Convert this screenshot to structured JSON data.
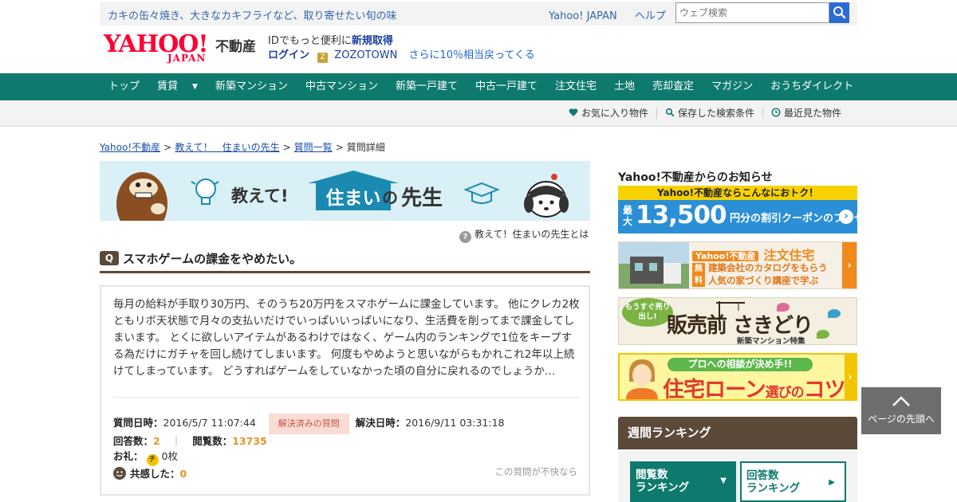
{
  "topbar": {
    "promo": "カキの缶々焼き、大きなカキフライなど、取り寄せたい旬の味",
    "yahoo_japan": "Yahoo! JAPAN",
    "help": "ヘルプ",
    "search_placeholder": "ウェブ検索"
  },
  "header": {
    "logo_text": "YAHOO!",
    "logo_japan": "JAPAN",
    "logo_sub": "不動産",
    "id_prefix": "IDでもっと便利に",
    "new_signup": "新規取得",
    "login": "ログイン",
    "zozo_icon": "Z",
    "zozotown": "ZOZOTOWN",
    "zozo_msg": "さらに10％相当戻ってくる"
  },
  "nav": [
    "トップ",
    "賃貸",
    "新築マンション",
    "中古マンション",
    "新築一戸建て",
    "中古一戸建て",
    "注文住宅",
    "土地",
    "売却査定",
    "マガジン",
    "おうちダイレクト"
  ],
  "nav_caret": "▼",
  "subnav": {
    "favorites": "お気に入り物件",
    "saved_search": "保存した検索条件",
    "recent": "最近見た物件"
  },
  "breadcrumb": {
    "home": "Yahoo!不動産",
    "section": "教えて！　住まいの先生",
    "list": "質問一覧",
    "current": "質問詳細",
    "sep": ">"
  },
  "banner": {
    "teach": "教えて!",
    "sumai": "住まい",
    "no": "の",
    "sensei": "先生"
  },
  "about": {
    "icon": "?",
    "text": "教えて！住まいの先生とは"
  },
  "question": {
    "badge": "Q",
    "title": "スマホゲームの課金をやめたい。",
    "body": "毎月の給料が手取り30万円、そのうち20万円をスマホゲームに課金しています。 他にクレカ2枚ともリボ天状態で月々の支払いだけでいっぱいいっぱいになり、生活費を削ってまで課金してしまいます。 とくに欲しいアイテムがあるわけではなく、ゲーム内のランキングで1位をキープする為だけにガチャを回し続けてしまいます。 何度もやめようと思いながらもかれこれ2年以上続けてしまっています。 どうすればゲームをしていなかった頃の自分に戻れるのでしょうか…",
    "asked_label": "質問日時：",
    "asked_at": "2016/5/7 11:07:44",
    "status": "解決済みの質問",
    "resolved_label": "解決日時：",
    "resolved_at": "2016/9/11 03:31:18",
    "answers_label": "回答数：",
    "answers": "2",
    "pipe": "｜",
    "views_label": "閲覧数：",
    "views": "13735",
    "reward_label": "お礼：",
    "coin": "チ",
    "reward": "0枚",
    "empathy_label": "共感した：",
    "empathy": "0",
    "report": "この質問が不快なら"
  },
  "sidebar": {
    "notice_title": "Yahoo!不動産からのお知らせ",
    "ad1": {
      "top": "Yahoo!不動産ならこんなにおトク！",
      "small": "最大",
      "big": "13,500",
      "mid": "円分の割引クーポンのプレゼント",
      "arrow": "›"
    },
    "ad2": {
      "logo": "Yahoo!不動産",
      "kind": "注文住宅",
      "free": "無料",
      "line1": "建築会社のカタログをもらう",
      "line2": "人気の家づくり講座で学ぶ",
      "arrow": "›"
    },
    "ad3": {
      "badge": "もうすぐ売り出し!",
      "main": "販売前 さきどり",
      "sub": "新築マンション特集"
    },
    "ad4": {
      "pill": "プロへの相談が決め手!!",
      "main_a": "住宅ローン",
      "main_b": "選び",
      "main_c": "の",
      "main_d": "コツ",
      "arrow": "›"
    },
    "ranking_title": "週間ランキング",
    "tab_views_1": "閲覧数",
    "tab_views_2": "ランキング",
    "tab_views_arrow": "▼",
    "tab_answers_1": "回答数",
    "tab_answers_2": "ランキング",
    "tab_answers_arrow": "▶"
  },
  "back_to_top": "ページの先頭へ",
  "colors": {
    "nav_green": "#0e7a6e",
    "brown": "#5b4a3a",
    "link_blue": "#1a4fa8",
    "yahoo_red": "#ff0033",
    "accent_orange": "#e8922a"
  }
}
